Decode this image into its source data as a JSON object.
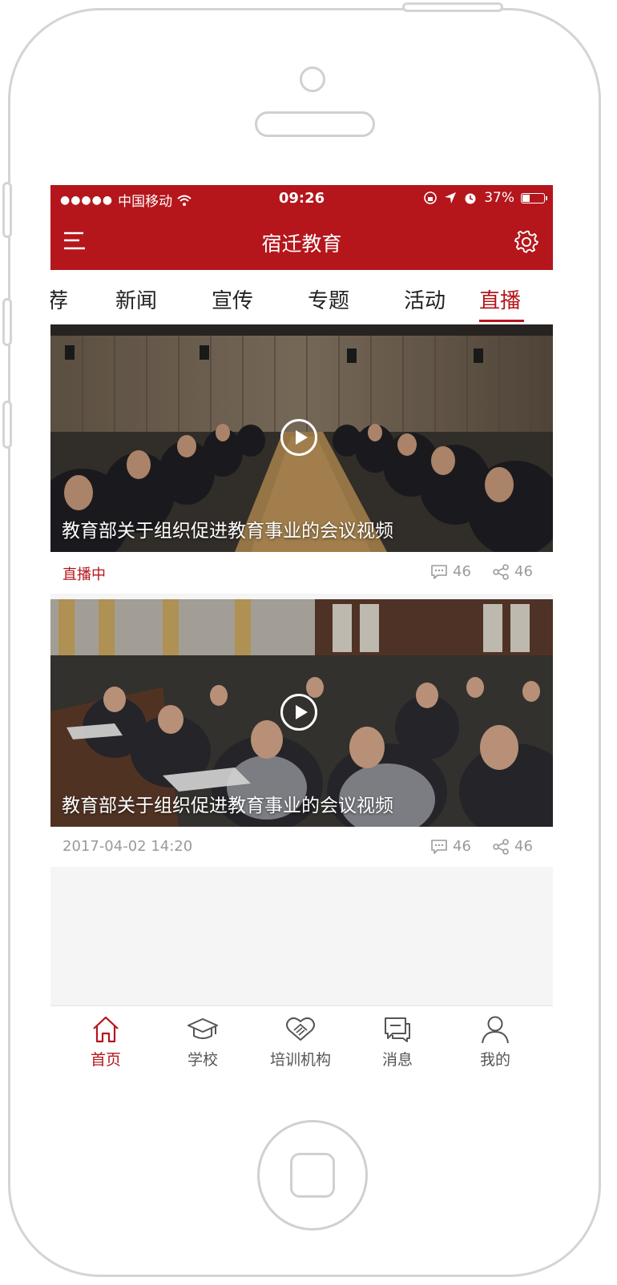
{
  "statusbar": {
    "carrier": "中国移动",
    "time": "09:26",
    "battery_percent": "37%",
    "battery_level": 0.37
  },
  "header": {
    "title": "宿迁教育"
  },
  "category_tabs": [
    {
      "label": "荐",
      "active": false
    },
    {
      "label": "新闻",
      "active": false
    },
    {
      "label": "宣传",
      "active": false
    },
    {
      "label": "专题",
      "active": false
    },
    {
      "label": "活动",
      "active": false
    },
    {
      "label": "直播",
      "active": true
    }
  ],
  "videos": [
    {
      "title": "教育部关于组织促进教育事业的会议视频",
      "status": "直播中",
      "comments": "46",
      "shares": "46"
    },
    {
      "title": "教育部关于组织促进教育事业的会议视频",
      "status": "2017-04-02  14:20",
      "comments": "46",
      "shares": "46"
    }
  ],
  "bottom_nav": [
    {
      "label": "首页",
      "icon": "home-icon",
      "active": true
    },
    {
      "label": "学校",
      "icon": "graduation-cap-icon",
      "active": false
    },
    {
      "label": "培训机构",
      "icon": "handshake-icon",
      "active": false
    },
    {
      "label": "消息",
      "icon": "chat-bubbles-icon",
      "active": false
    },
    {
      "label": "我的",
      "icon": "user-icon",
      "active": false
    }
  ],
  "colors": {
    "brand": "#b4161c",
    "muted": "#9a9a9a"
  }
}
